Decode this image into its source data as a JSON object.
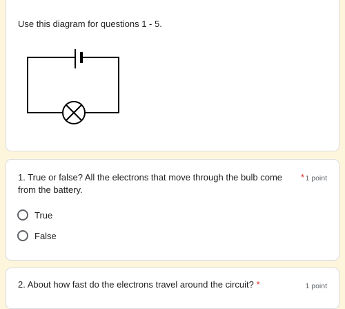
{
  "intro": {
    "text": "Use this diagram for questions 1 - 5."
  },
  "questions": [
    {
      "text": "1.  True or false? All the electrons that move through the bulb come from the battery.",
      "required_mark": "*",
      "points": "1 point",
      "options": [
        {
          "label": "True"
        },
        {
          "label": "False"
        }
      ]
    },
    {
      "text": "2.  About how fast do the electrons travel around the circuit? ",
      "required_mark": "*",
      "points": "1 point"
    }
  ],
  "colors": {
    "background": "#fdf5dc",
    "card": "#ffffff",
    "required": "#d93025",
    "muted": "#5f6368"
  }
}
